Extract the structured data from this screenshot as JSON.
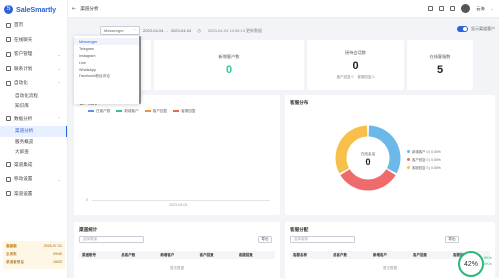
{
  "app": {
    "brand": "SaleSmartly",
    "page_title": "渠道分析",
    "collapse_icon": "collapse-icon",
    "back_icon": "back-icon"
  },
  "sidebar": {
    "items": [
      {
        "label": "首页",
        "icon": "home-icon"
      },
      {
        "label": "在线聊天",
        "icon": "chat-icon"
      },
      {
        "label": "客户管理",
        "icon": "users-icon"
      },
      {
        "label": "联系计划",
        "icon": "calendar-icon"
      },
      {
        "label": "自动化",
        "icon": "robot-icon"
      }
    ],
    "automation_subs": [
      "自动化流程",
      "知识库"
    ],
    "data_report": {
      "label": "数据分析",
      "icon": "chart-icon",
      "subs": [
        "渠道分析",
        "服务概览",
        "大屏查"
      ]
    },
    "bottom_items": [
      {
        "label": "渠道集成",
        "icon": "plug-icon"
      },
      {
        "label": "移动设置",
        "icon": "gear-icon"
      },
      {
        "label": "渠道设置",
        "icon": "settings-icon"
      }
    ],
    "promo": {
      "plan": "高级版",
      "expire": "2025-07-31",
      "seats_label": "坐席数",
      "seats": "29/40",
      "channels_label": "渠道套餐量",
      "channels": "15/20"
    }
  },
  "topbar": {
    "username": "云海"
  },
  "filter": {
    "channel_value": "Messenger",
    "date_start": "2023-04-04",
    "date_sep": "-",
    "date_end": "2023-04-04",
    "updated": "2023-04-04 14:35:13 更新数据",
    "toggle_label": "显示渠道客户"
  },
  "channel_options": [
    "Messenger",
    "Telegram",
    "Instagram",
    "Line",
    "WhatsApp",
    "Facebook粉丝评论"
  ],
  "stats": [
    {
      "label": "新增客户数",
      "value": "0"
    },
    {
      "label": "接待会话数",
      "value": "0",
      "sub_a": "客户回复 0",
      "sub_b": "客服回复 0"
    },
    {
      "label": "在线客服数",
      "value": "5"
    }
  ],
  "trend": {
    "title": "客户趋势",
    "legend": [
      {
        "name": "在客户数",
        "color": "#5b8ff9"
      },
      {
        "name": "新增客户",
        "color": "#30c5a0"
      },
      {
        "name": "客户回复",
        "color": "#f6903d"
      },
      {
        "name": "客服回复",
        "color": "#e8684a"
      }
    ],
    "y_zero": "0",
    "x_label": "2023-04-04"
  },
  "distribution": {
    "title": "客服分布",
    "center_label": "在线会话",
    "center_value": "0",
    "legend": [
      {
        "name": "新增客户 0 | 0.00%",
        "color": "#6cb8e8"
      },
      {
        "name": "客户回复 0 | 0.00%",
        "color": "#ef6b6b"
      },
      {
        "name": "客服回复 0 | 0.00%",
        "color": "#f6c04b"
      }
    ]
  },
  "chart_data": {
    "type": "pie",
    "categories": [
      "新增客户",
      "客户回复",
      "客服回复"
    ],
    "values": [
      0,
      0,
      0
    ],
    "title": "客服分布"
  },
  "channel_stats": {
    "title": "渠道统计",
    "select_placeholder": "选择渠道",
    "export_label": "导出",
    "columns": [
      "渠道账号",
      "总客户数",
      "新增客户",
      "客户回复",
      "客服回复"
    ],
    "empty": "暂无数据"
  },
  "service_stats": {
    "title": "客服分配",
    "select_placeholder": "选择客服",
    "export_label": "导出",
    "columns": [
      "客服名称",
      "总客户数",
      "新增客户",
      "客户回复",
      "客服回复"
    ],
    "empty": "暂无数据"
  },
  "perf": {
    "percent": "42%",
    "up": "0K/s",
    "down": "0K/s"
  }
}
